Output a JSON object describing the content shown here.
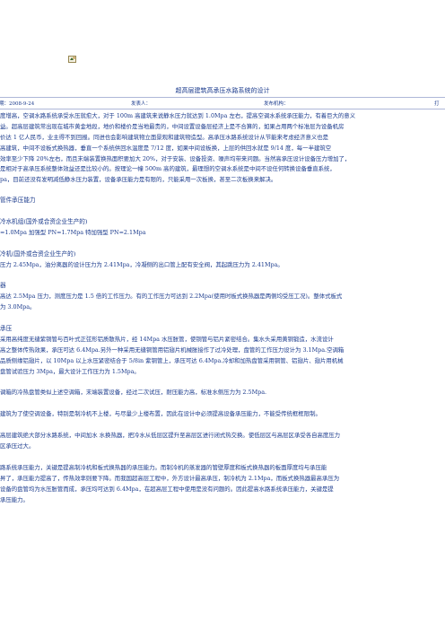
{
  "header": {
    "logo_icon": "document-logo-icon",
    "title": "超高层建筑高承压水路系统的设计",
    "meta": {
      "date_label": "期：2008-9-24",
      "publisher_label": "发表人：",
      "institution_label": "发布机构：",
      "extra_label": "打"
    }
  },
  "lines": [
    "度增高，空调水路系统承受水压就愈大，对于 100m 高建筑来说静水压力就达到 1.0Mpa 左右，提高空调水系统承压能力，有着巨大的意义",
    "益。超高层建筑常出现在城市黄金地段，地价和楼价是当地最贵的，中间设置设备层经济上是不合算的，如果占用两个标准层为设备机房",
    "价达 1 亿人民币，业主得不到回报。同进也会影响建筑物立面景观和建筑物造型。高承压水路系统设计从节能来考虑经济意义也是",
    "高建筑，中间不设板式换热器，垂直一个系统供回水温度是 7/12 度，如果中间设板换，上层的供回水就是 9/14 度，每一半建筑空",
    "效率至少下降 20%左右，而且末端装置换热面积要加大 20%，对于安装、设备投资、噪声均带来问题。当然高承压设计设备压力增加了，",
    "是相对于高承压系统整体效益还是比较小的。按理论一幢 500m 高的建筑，最理想的空调水系统是中间不设任何转换设备垂直系统，",
    "pa，目前还没有发明减低静水压力装置，设备承压能力是有限的，只能采用一次板换，甚至二次板换来解决。",
    "管件承压能力",
    "冷水机组(国外或合资企业生产的)",
    "=1.0Mpa  加强型  PN=1.7Mpa  特加强型  PN=2.1Mpa",
    "冷机(国外或合资企业生产的)",
    "压力 2.45Mpa，油分离器的设计压力为 2.41Mpa，冷凝侧的出口管上配有安全阀，其起跳压力为 2.41Mpa。",
    "器",
    "高达 2.5Mpa 压力，测度压力是 1.5 倍的工作压力。有的工作压力可达到 2.2Mpa(使用时板式换热器是两侧均受压工况)。整体式板式",
    "为 3.0Mpa。",
    "承压",
    "采用高纯度无缝紫铜管与百叶式正弦形铝质散热片，经 14Mpa 水压胀管，使铜管与铝片紧密结合。集水头采用黄铜锻造，水流设计",
    "高之整体传热效果，承压可达 6.4Mpa.另外一种采用无缝铜管用铝翅片机械胀接作了过冷处理，盘管的工作压力设计为 3.1Mpa.空调箱",
    "品质侧缘铝翅片，以 10Mpa 以上水压紧密结合于 5/8in 紫铜管上，承压可达 6.4Mpa.冷却和加热盘管采用铜管、铝翅片、翅片用机械",
    "盘管试验压力 3Mpa，最大设计工作压力为 1.5Mpa。",
    "调箱的冷热盘管类似上述空调箱，末端装置设备，经过二次试压，耐压能力高，标准水侧压力为 2.5Mpa.",
    "建筑为了使空调设备，特别是制冷机不上楼，与尽量少上楼布置，因此在设计中必须提高设备承压能力，不能受传统框框限制。",
    "高层建筑绝大部分水路系统，中间加水 水换热器，把冷水从低层区提升至高层区进行闭式热交换。使低层区与高层区承受各自高度压力",
    "区承压过大。",
    "路系统承压能力，关键是提高制冷机和板式换热器的承压能力。而制冷机的蒸发器的管壁厚度和板式换热器的板面厚度均与承压能",
    "昇了，承压能力提高了，传热效率则要下降。而我国超高层工程中，外方设计最高承压，制冷机为 2.1Mpa，而板式换热器最高承压为",
    "设备的盘管均为水压胀管而成，承压均可达到 6.4Mpa，在超高层工程中使用是没有问题的。因此提高水路系统承压能力，关键是提",
    "承压能力。"
  ]
}
